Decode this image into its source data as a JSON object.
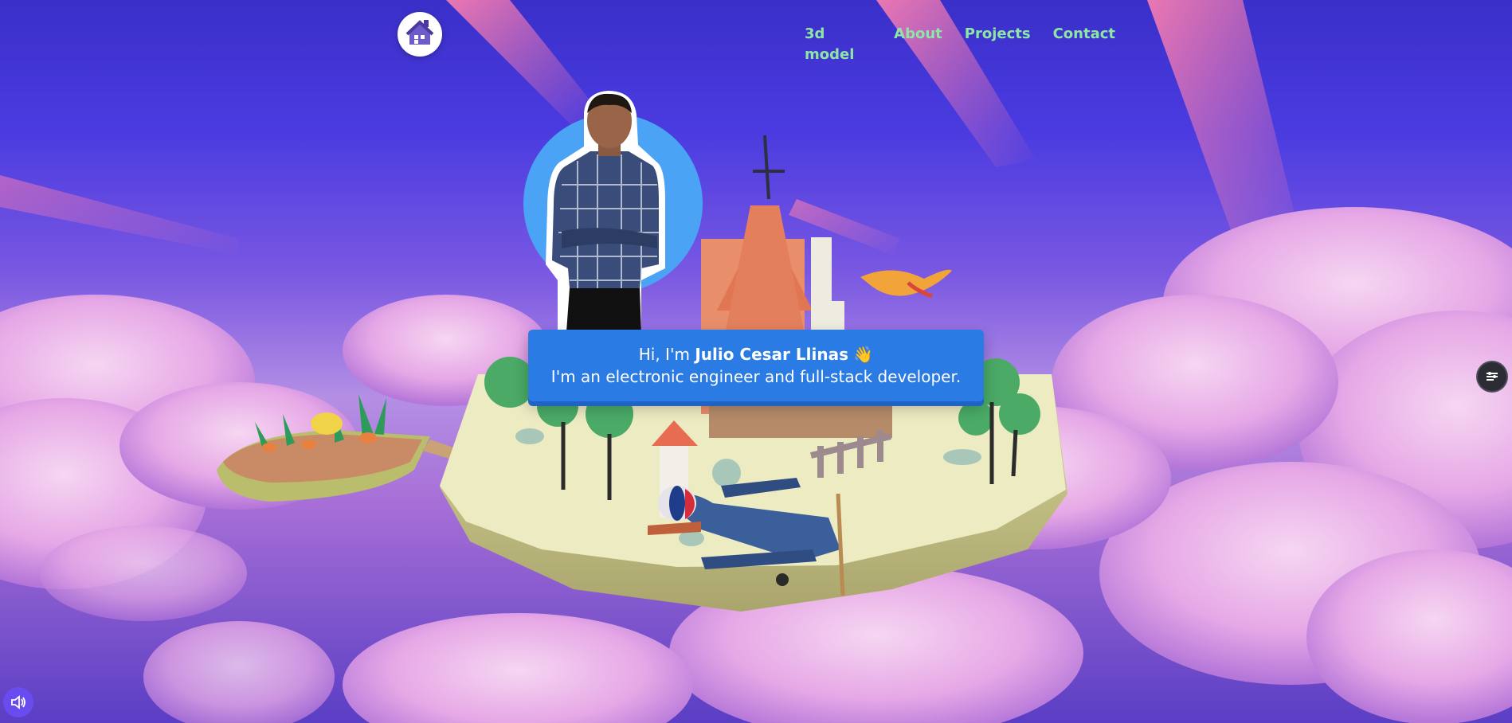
{
  "nav": {
    "links": [
      "3d model",
      "About",
      "Projects",
      "Contact"
    ],
    "logo_icon": "house-icon"
  },
  "hero": {
    "greeting_prefix": "Hi, I'm",
    "name": "Julio Cesar Llinas",
    "wave": "👋",
    "tagline": "I'm an electronic engineer and full-stack developer."
  },
  "controls": {
    "side_icon": "settings-list-icon",
    "sound_icon": "speaker-icon"
  },
  "colors": {
    "nav_link": "#8ee6a6",
    "speech_bg": "#2a7be4",
    "profile_circle": "#4aa3f5",
    "sound_button": "#6a4bf0"
  }
}
